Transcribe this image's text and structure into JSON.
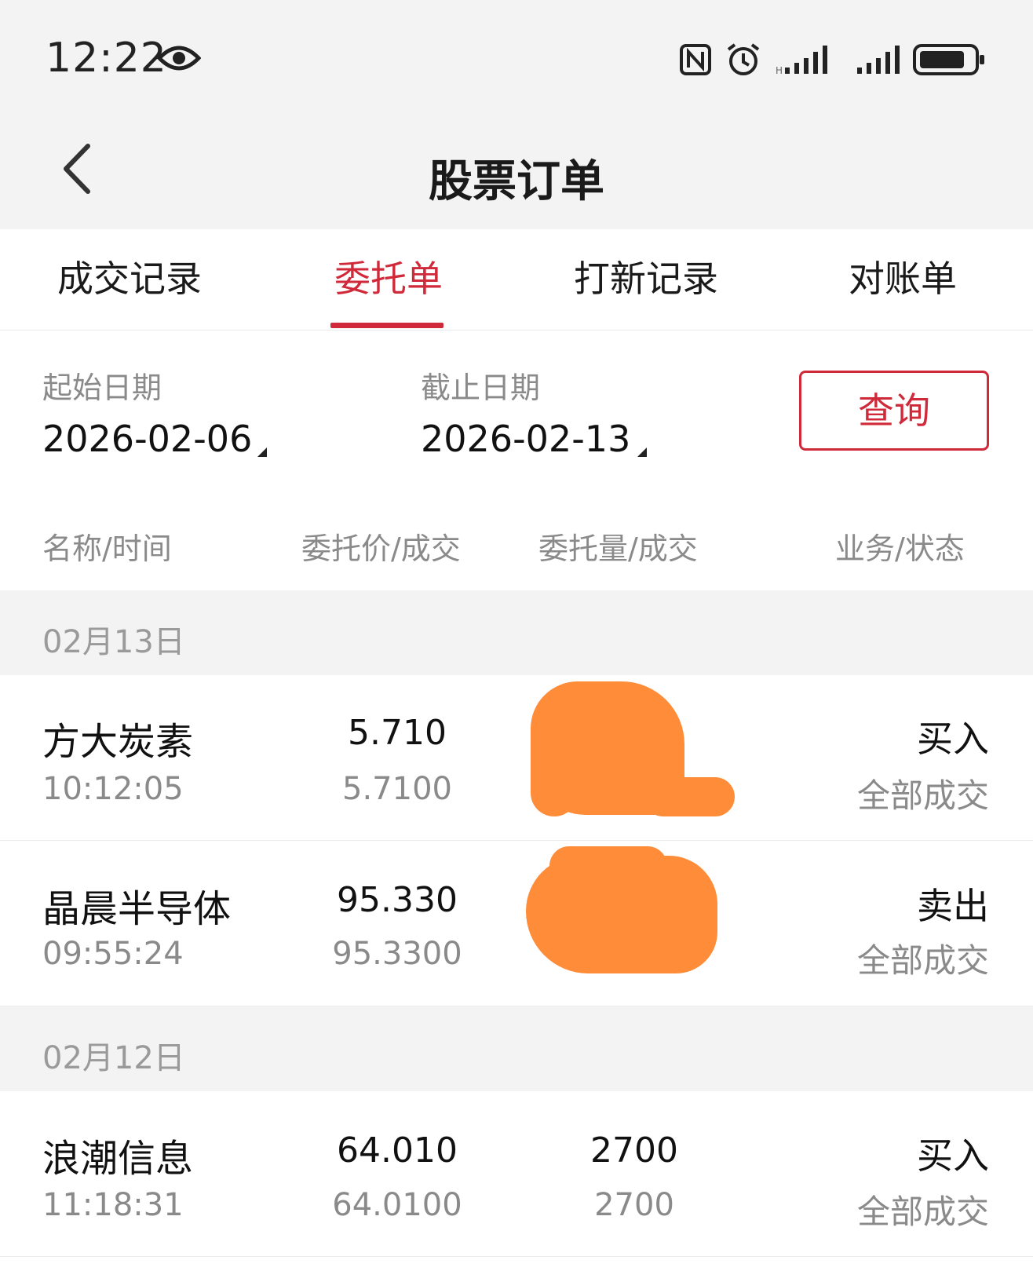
{
  "status_bar": {
    "time": "12:22"
  },
  "header": {
    "title": "股票订单"
  },
  "tabs": [
    {
      "label": "成交记录",
      "active": false
    },
    {
      "label": "委托单",
      "active": true
    },
    {
      "label": "打新记录",
      "active": false
    },
    {
      "label": "对账单",
      "active": false
    }
  ],
  "filters": {
    "start_label": "起始日期",
    "start_value": "2026-02-06",
    "end_label": "截止日期",
    "end_value": "2026-02-13",
    "query_label": "查询"
  },
  "columns": [
    "名称/时间",
    "委托价/成交",
    "委托量/成交",
    "业务/状态"
  ],
  "groups": [
    {
      "date": "02月13日",
      "orders": [
        {
          "name": "方大炭素",
          "time": "10:12:05",
          "price": "5.710",
          "deal_price": "5.7100",
          "qty": "",
          "deal_qty": "",
          "type": "买入",
          "status": "全部成交"
        },
        {
          "name": "晶晨半导体",
          "time": "09:55:24",
          "price": "95.330",
          "deal_price": "95.3300",
          "qty": "",
          "deal_qty": "",
          "type": "卖出",
          "status": "全部成交"
        }
      ]
    },
    {
      "date": "02月12日",
      "orders": [
        {
          "name": "浪潮信息",
          "time": "11:18:31",
          "price": "64.010",
          "deal_price": "64.0100",
          "qty": "2700",
          "deal_qty": "2700",
          "type": "买入",
          "status": "全部成交"
        }
      ]
    }
  ],
  "colors": {
    "accent": "#d0293a",
    "redaction": "#ff8c38"
  }
}
